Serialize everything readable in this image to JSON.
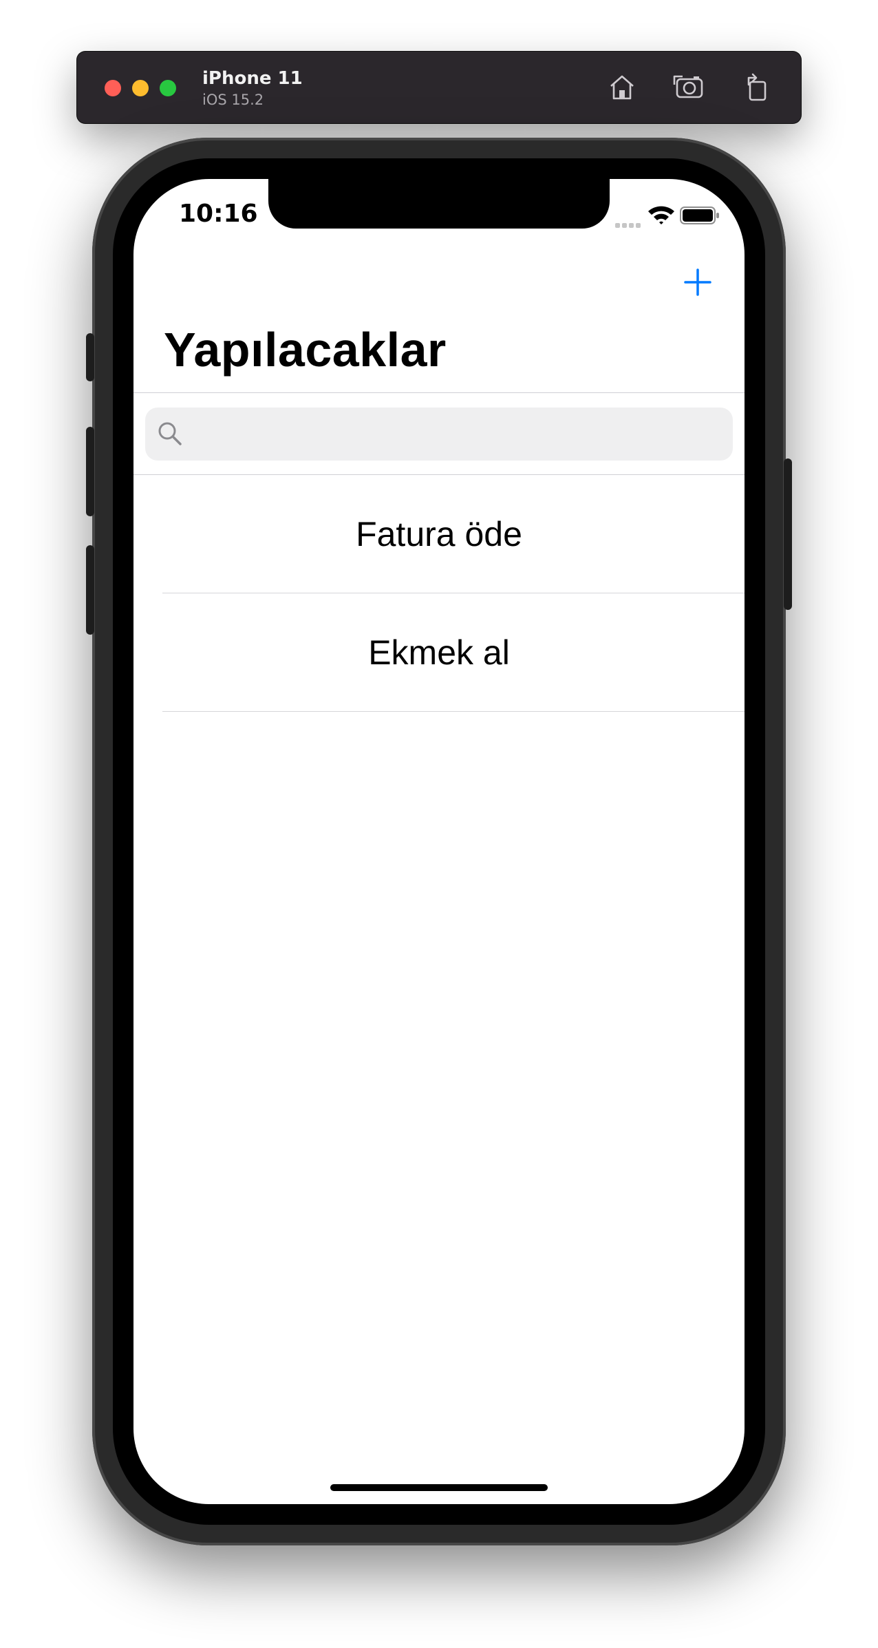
{
  "simulator": {
    "device_name": "iPhone 11",
    "os_version": "iOS 15.2",
    "toolbar_icons": [
      "home-icon",
      "screenshot-icon",
      "rotate-icon"
    ]
  },
  "status_bar": {
    "time": "10:16",
    "icons": [
      "cellular-signal-icon",
      "wifi-icon",
      "battery-icon"
    ]
  },
  "nav": {
    "large_title": "Yapılacaklar",
    "add_icon": "plus-icon",
    "accent_color": "#007aff"
  },
  "search": {
    "placeholder": "",
    "value": "",
    "icon": "search-icon"
  },
  "list": {
    "items": [
      {
        "label": "Fatura öde"
      },
      {
        "label": "Ekmek al"
      }
    ]
  }
}
